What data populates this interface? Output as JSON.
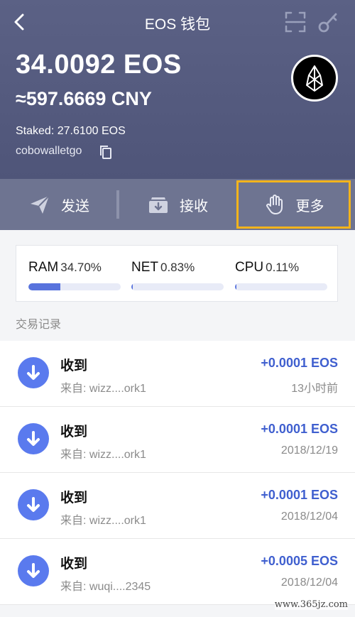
{
  "nav": {
    "title": "EOS 钱包",
    "back_icon": "chevron-left-icon",
    "scan_icon": "scan-icon",
    "key_icon": "key-icon"
  },
  "wallet": {
    "balance": "34.0092 EOS",
    "fiat": "≈597.6669 CNY",
    "staked": "Staked: 27.6100 EOS",
    "account": "cobowalletgo"
  },
  "actions": {
    "send_label": "发送",
    "receive_label": "接收",
    "more_label": "更多"
  },
  "resources": [
    {
      "name": "RAM",
      "value": "34.70%",
      "fraction": 0.347
    },
    {
      "name": "NET",
      "value": "0.83%",
      "fraction": 0.0083
    },
    {
      "name": "CPU",
      "value": "0.11%",
      "fraction": 0.0011
    }
  ],
  "section_title": "交易记录",
  "transactions": [
    {
      "title": "收到",
      "from": "来自: wizz....ork1",
      "amount": "+0.0001 EOS",
      "time": "13小时前"
    },
    {
      "title": "收到",
      "from": "来自: wizz....ork1",
      "amount": "+0.0001 EOS",
      "time": "2018/12/19"
    },
    {
      "title": "收到",
      "from": "来自: wizz....ork1",
      "amount": "+0.0001 EOS",
      "time": "2018/12/04"
    },
    {
      "title": "收到",
      "from": "来自: wuqi....2345",
      "amount": "+0.0005 EOS",
      "time": "2018/12/04"
    }
  ],
  "watermark": "www.365jz.com",
  "colors": {
    "header": "#575d82",
    "action_bar": "#6e7491",
    "highlight": "#f3b41c",
    "accent": "#3f5fcf",
    "receive_icon_bg": "#5a7aee"
  }
}
